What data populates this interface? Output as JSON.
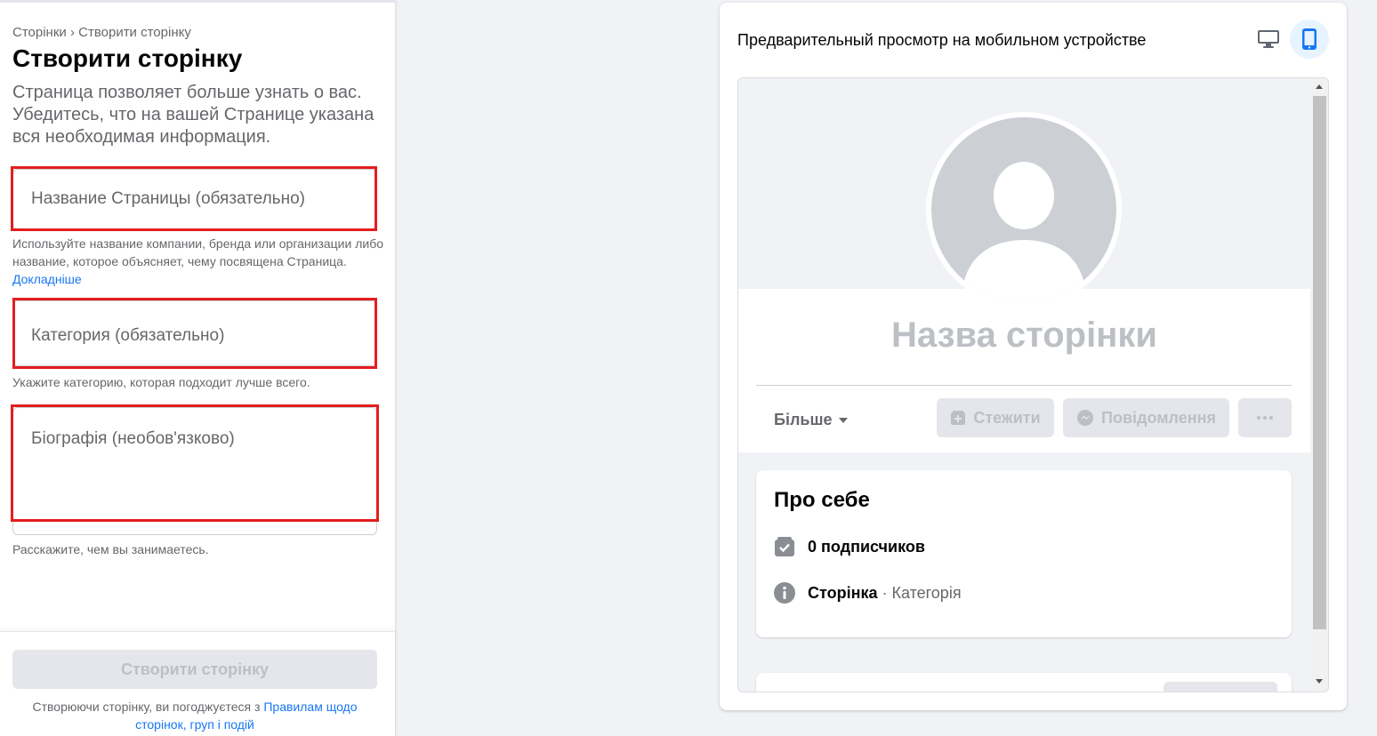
{
  "breadcrumb": {
    "parent": "Сторінки",
    "separator": "›",
    "current": "Створити сторінку"
  },
  "form": {
    "title": "Створити сторінку",
    "intro": "Страница позволяет больше узнать о вас. Убедитесь, что на вашей Странице указана вся необходимая информация.",
    "name_placeholder": "Название Страницы (обязательно)",
    "name_hint": "Используйте название компании, бренда или организации либо название, которое объясняет, чему посвящена Страница.",
    "name_hint_link": "Докладніше",
    "category_placeholder": "Категория (обязательно)",
    "category_hint": "Укажите категорию, которая подходит лучше всего.",
    "bio_placeholder": "Біографія (необов'язково)",
    "bio_hint": "Расскажите, чем вы занимаетесь."
  },
  "footer": {
    "create_button": "Створити сторінку",
    "terms_prefix": "Створюючи сторінку, ви погоджуєтеся з",
    "terms_link": "Правилам щодо сторінок, груп і подій"
  },
  "preview": {
    "title": "Предварительный просмотр на мобильном устройстве",
    "desktop_icon": "desktop-icon",
    "mobile_icon": "mobile-icon",
    "page_name": "Назва сторінки",
    "more_label": "Більше",
    "follow_label": "Стежити",
    "message_label": "Повідомлення",
    "about_title": "Про себе",
    "followers": "0 подписчиков",
    "page_label": "Сторінка",
    "category_sep": " · ",
    "category_label": "Категорія"
  },
  "colors": {
    "accent": "#1877f2",
    "highlight_box": "#e41e1e",
    "disabled_bg": "#e4e6eb",
    "disabled_text": "#bcc0c4"
  }
}
